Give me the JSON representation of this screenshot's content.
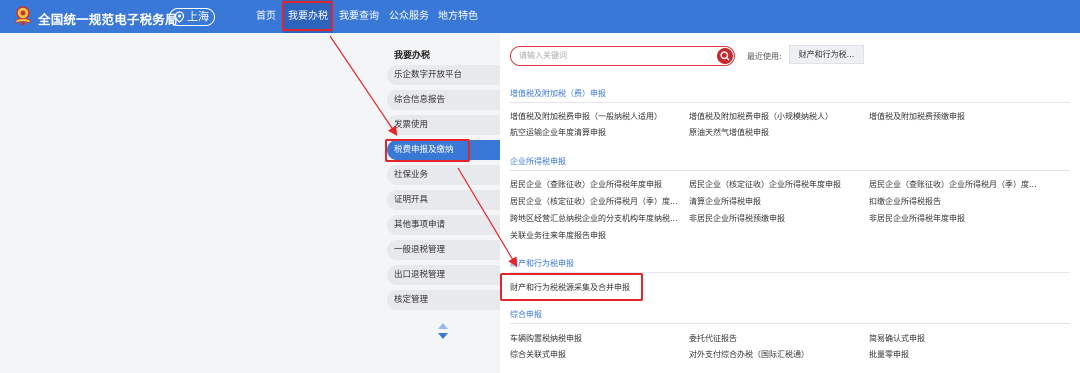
{
  "header": {
    "brand": "全国统一规范电子税务局",
    "region": "上海",
    "nav": [
      {
        "label": "首页"
      },
      {
        "label": "我要办税"
      },
      {
        "label": "我要查询"
      },
      {
        "label": "公众服务"
      },
      {
        "label": "地方特色"
      }
    ]
  },
  "sidebar": {
    "title": "我要办税",
    "items": [
      {
        "label": "乐企数字开放平台"
      },
      {
        "label": "综合信息报告"
      },
      {
        "label": "发票使用"
      },
      {
        "label": "税费申报及缴纳"
      },
      {
        "label": "社保业务"
      },
      {
        "label": "证明开具"
      },
      {
        "label": "其他事项申请"
      },
      {
        "label": "一般退税管理"
      },
      {
        "label": "出口退税管理"
      },
      {
        "label": "核定管理"
      }
    ]
  },
  "search": {
    "placeholder": "请输入关键词",
    "recent_label": "最近使用:",
    "recent_item": "财产和行为税..."
  },
  "sections": [
    {
      "title": "增值税及附加税（费）申报",
      "links": [
        "增值税及附加税费申报（一般纳税人适用）",
        "增值税及附加税费申报（小规模纳税人）",
        "增值税及附加税费预缴申报",
        "航空运输企业年度清算申报",
        "原油天然气增值税申报"
      ]
    },
    {
      "title": "企业所得税申报",
      "links": [
        "居民企业（查账征收）企业所得税年度申报",
        "居民企业（核定征收）企业所得税年度申报",
        "居民企业（查账征收）企业所得税月（季）度...",
        "居民企业（核定征收）企业所得税月（季）度...",
        "清算企业所得税申报",
        "扣缴企业所得税报告",
        "跨地区经营汇总纳税企业的分支机构年度纳税...",
        "非居民企业所得税预缴申报",
        "非居民企业所得税年度申报",
        "关联业务往来年度报告申报"
      ]
    },
    {
      "title": "财产和行为税申报",
      "links": [
        "财产和行为税税源采集及合并申报"
      ]
    },
    {
      "title": "综合申报",
      "links": [
        "车辆购置税纳税申报",
        "委托代征报告",
        "简易确认式申报",
        "综合关联式申报",
        "对外支付综合办税（国际汇税通）",
        "批量零申报"
      ]
    }
  ],
  "colors": {
    "header_bg": "#3a78d8",
    "active_nav_bg": "#2b63bd",
    "highlight_red": "#e3252b",
    "link_blue": "#3a78d8"
  }
}
